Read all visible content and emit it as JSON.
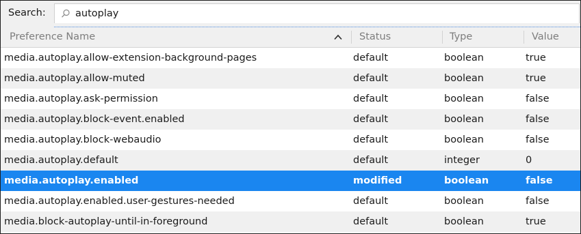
{
  "search": {
    "label": "Search:",
    "value": "autoplay",
    "icon": "search-icon"
  },
  "columns": {
    "name": "Preference Name",
    "status": "Status",
    "type": "Type",
    "value": "Value",
    "sort": {
      "column": "name",
      "direction": "ascending",
      "icon": "chevron-up-icon"
    }
  },
  "rows": [
    {
      "name": "media.autoplay.allow-extension-background-pages",
      "status": "default",
      "type": "boolean",
      "value": "true"
    },
    {
      "name": "media.autoplay.allow-muted",
      "status": "default",
      "type": "boolean",
      "value": "true"
    },
    {
      "name": "media.autoplay.ask-permission",
      "status": "default",
      "type": "boolean",
      "value": "false"
    },
    {
      "name": "media.autoplay.block-event.enabled",
      "status": "default",
      "type": "boolean",
      "value": "false"
    },
    {
      "name": "media.autoplay.block-webaudio",
      "status": "default",
      "type": "boolean",
      "value": "false"
    },
    {
      "name": "media.autoplay.default",
      "status": "default",
      "type": "integer",
      "value": "0"
    },
    {
      "name": "media.autoplay.enabled",
      "status": "modified",
      "type": "boolean",
      "value": "false"
    },
    {
      "name": "media.autoplay.enabled.user-gestures-needed",
      "status": "default",
      "type": "boolean",
      "value": "false"
    },
    {
      "name": "media.block-autoplay-until-in-foreground",
      "status": "default",
      "type": "boolean",
      "value": "true"
    }
  ],
  "selected_row": 6,
  "colors": {
    "selection": "#1a86f0",
    "alternate_row": "#f0f0f0",
    "header_text": "#7d7d7d"
  }
}
